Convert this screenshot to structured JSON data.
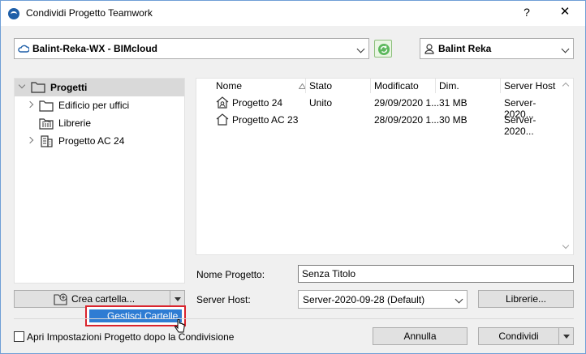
{
  "window": {
    "title": "Condividi Progetto Teamwork",
    "help": "?",
    "close": "✕"
  },
  "server_combo": {
    "value": "Balint-Reka-WX - BIMcloud"
  },
  "user_combo": {
    "value": "Balint Reka"
  },
  "tree": {
    "items": [
      {
        "label": "Progetti",
        "icon": "folder-icon",
        "expanded": true,
        "selected": true
      },
      {
        "label": "Edificio per uffici",
        "icon": "folder-icon",
        "expanded": false
      },
      {
        "label": "Librerie",
        "icon": "library-icon"
      },
      {
        "label": "Progetto AC 24",
        "icon": "building-icon",
        "expanded": false
      }
    ]
  },
  "list": {
    "columns": [
      "Nome",
      "Stato",
      "Modificato",
      "Dim.",
      "Server Host"
    ],
    "rows": [
      {
        "name": "Progetto 24",
        "status": "Unito",
        "modified": "29/09/2020 1...",
        "size": "31 MB",
        "host": "Server-2020..."
      },
      {
        "name": "Progetto AC 23",
        "status": "",
        "modified": "28/09/2020 1...",
        "size": "30 MB",
        "host": "Server-2020..."
      }
    ]
  },
  "form": {
    "project_name_label": "Nome Progetto:",
    "project_name_value": "Senza Titolo",
    "server_host_label": "Server Host:",
    "server_host_value": "Server-2020-09-28 (Default)",
    "libraries_button": "Librerie..."
  },
  "create_folder_button": "Crea cartella...",
  "popup": {
    "item": "Gestisci Cartelle..."
  },
  "footer": {
    "checkbox_label": "Apri Impostazioni Progetto dopo la Condivisione",
    "cancel_button": "Annulla",
    "share_button": "Condividi"
  },
  "colors": {
    "accent": "#2e7cd3",
    "highlight_border": "#d9232d",
    "selected_row": "#d9d9d9"
  }
}
